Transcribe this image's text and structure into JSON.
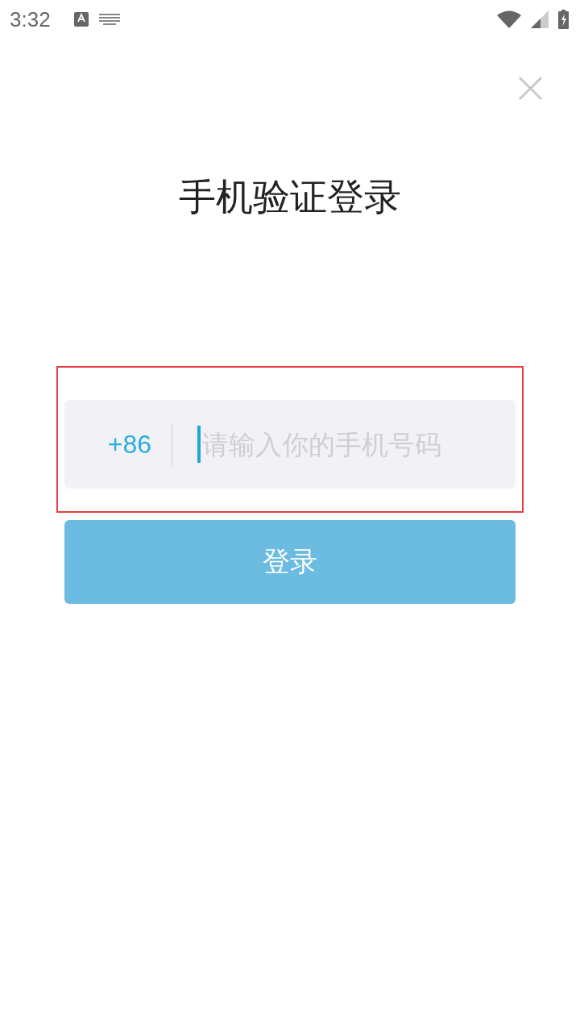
{
  "status_bar": {
    "time": "3:32"
  },
  "close_button": {
    "label": "×"
  },
  "title": "手机验证登录",
  "phone_field": {
    "country_code": "+86",
    "placeholder": "请输入你的手机号码",
    "focused": true,
    "highlighted": true
  },
  "login_button": {
    "label": "登录",
    "disabled": true
  }
}
